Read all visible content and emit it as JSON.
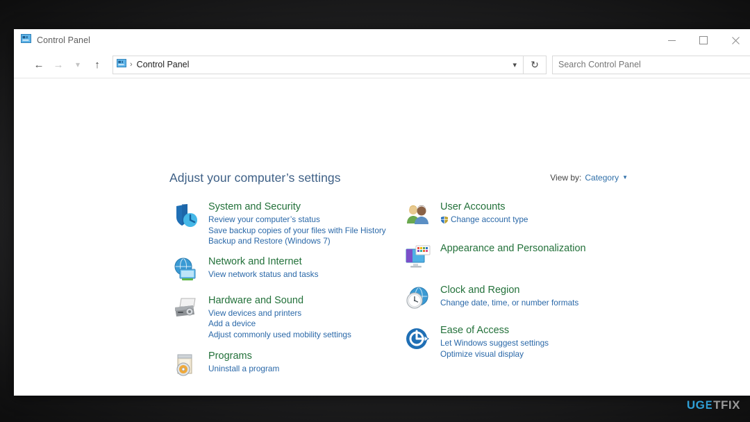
{
  "window": {
    "title": "Control Panel",
    "title_icon": "control-panel-icon",
    "controls": {
      "minimize": "minimize-button",
      "maximize": "maximize-button",
      "close": "close-button"
    }
  },
  "nav": {
    "back": "back-arrow-icon",
    "forward": "forward-arrow-icon",
    "recent": "chevron-down-icon",
    "up": "up-arrow-icon",
    "address_icon": "control-panel-icon",
    "address_separator": "›",
    "address_text": "Control Panel",
    "address_dropdown": "chevron-down-icon",
    "refresh": "refresh-icon",
    "search_placeholder": "Search Control Panel"
  },
  "main": {
    "heading": "Adjust your computer’s settings",
    "view_by_label": "View by:",
    "view_by_value": "Category"
  },
  "categories": {
    "left": [
      {
        "icon": "shield-icon",
        "title": "System and Security",
        "links": [
          "Review your computer’s status",
          "Save backup copies of your files with File History",
          "Backup and Restore (Windows 7)"
        ]
      },
      {
        "icon": "globe-monitor-icon",
        "title": "Network and Internet",
        "links": [
          "View network status and tasks"
        ]
      },
      {
        "icon": "printer-icon",
        "title": "Hardware and Sound",
        "links": [
          "View devices and printers",
          "Add a device",
          "Adjust commonly used mobility settings"
        ]
      },
      {
        "icon": "programs-disc-icon",
        "title": "Programs",
        "links": [
          "Uninstall a program"
        ]
      }
    ],
    "right": [
      {
        "icon": "users-icon",
        "title": "User Accounts",
        "links": [
          "Change account type"
        ],
        "shield_on_first_link": true
      },
      {
        "icon": "monitor-palette-icon",
        "title": "Appearance and Personalization",
        "links": []
      },
      {
        "icon": "clock-globe-icon",
        "title": "Clock and Region",
        "links": [
          "Change date, time, or number formats"
        ]
      },
      {
        "icon": "ease-of-access-icon",
        "title": "Ease of Access",
        "links": [
          "Let Windows suggest settings",
          "Optimize visual display"
        ]
      }
    ]
  },
  "watermark": {
    "part1": "UG",
    "part2": "E",
    "part3": "TFIX"
  },
  "colors": {
    "category_title": "#23713a",
    "link": "#2a68a8",
    "heading": "#3d5f85",
    "accent_blue": "#2f9fd6"
  }
}
